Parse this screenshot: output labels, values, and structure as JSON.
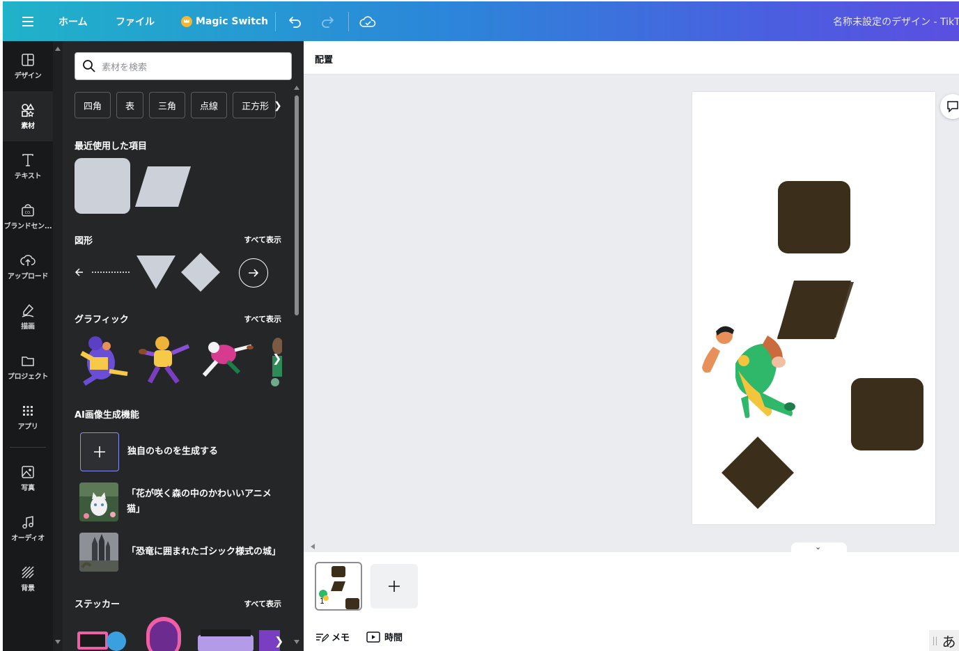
{
  "topbar": {
    "menu_icon": "hamburger-icon",
    "home_label": "ホーム",
    "file_label": "ファイル",
    "magic_switch_label": "Magic Switch",
    "title": "名称未設定のデザイン - TikTok"
  },
  "rail": {
    "items": [
      {
        "label": "デザイン",
        "icon": "layout-icon"
      },
      {
        "label": "素材",
        "icon": "shapes-icon"
      },
      {
        "label": "テキスト",
        "icon": "text-icon"
      },
      {
        "label": "ブランドセン...",
        "icon": "brand-icon"
      },
      {
        "label": "アップロード",
        "icon": "upload-icon"
      },
      {
        "label": "描画",
        "icon": "draw-icon"
      },
      {
        "label": "プロジェクト",
        "icon": "folder-icon"
      },
      {
        "label": "アプリ",
        "icon": "apps-icon"
      },
      {
        "label": "写真",
        "icon": "photo-icon"
      },
      {
        "label": "オーディオ",
        "icon": "audio-icon"
      },
      {
        "label": "背景",
        "icon": "background-icon"
      }
    ]
  },
  "panel": {
    "search_placeholder": "素材を検索",
    "chips": [
      "四角",
      "表",
      "三角",
      "点線",
      "正方形"
    ],
    "recent_title": "最近使用した項目",
    "shapes_title": "図形",
    "graphics_title": "グラフィック",
    "ai_title": "AI画像生成機能",
    "stickers_title": "ステッカー",
    "see_all": "すべて表示",
    "ai_generate_label": "独自のものを生成する",
    "ai_prompts": [
      "「花が咲く森の中のかわいいアニメ猫」",
      "「恐竜に囲まれたゴシック様式の城」"
    ]
  },
  "editor": {
    "position_label": "配置",
    "page_number": "1",
    "notes_label": "メモ",
    "time_label": "時間",
    "shape_color": "#3b2e1a"
  },
  "ime": {
    "label": "あ"
  }
}
